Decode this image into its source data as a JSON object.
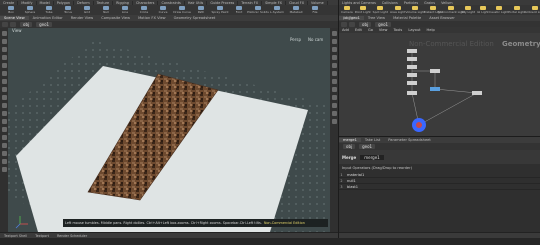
{
  "left_shelf_tabs": [
    "Create",
    "Modify",
    "Model",
    "Polygon",
    "Deform",
    "Texture",
    "Rigging",
    "Characters",
    "Constraints",
    "Hair Utils",
    "Guide Process",
    "Terrain FX",
    "Simple FX",
    "Cloud FX",
    "Volume"
  ],
  "left_tools": [
    "Box",
    "Sphere",
    "Tube",
    "Torus",
    "Grid",
    "Null",
    "Line",
    "Circle",
    "Curve",
    "Draw Curve",
    "Path",
    "Spray Paint",
    "Font",
    "Platonic Solids",
    "L-System",
    "Metaball",
    "File"
  ],
  "right_shelf_tabs": [
    "Lights and Cameras",
    "Collisions",
    "Particles",
    "Grains",
    "Vellum"
  ],
  "lights_tools": [
    "Camera",
    "Point Light",
    "Spot Light",
    "Area Light",
    "Volume Light",
    "Distant Light",
    "Environment Light",
    "Sky Light",
    "GI Light",
    "Caustic Light",
    "Portal Light",
    "Ambient Light"
  ],
  "viewport_tabs": [
    "Scene View",
    "Animation Editor",
    "Render View",
    "Composite View",
    "Motion FX View",
    "Geometry Spreadsheet"
  ],
  "viewport_path": {
    "obj": "obj",
    "node": "geo1"
  },
  "viewport_label": "View",
  "viewport_persp": "Persp",
  "viewport_cam": "No cam",
  "viewport_status": "Left mouse tumbles. Middle pans. Right dollies. Ctrl+Alt+Left box-zooms. Ctrl+Right zooms. Spacebar-Ctrl-Left tilts.",
  "viewport_status_highlight": "Non-Commercial Edition",
  "network_tabs": [
    "/obj/geo1",
    "Tree View",
    "Material Palette",
    "Asset Browser"
  ],
  "network_path": {
    "obj": "obj",
    "node": "geo1"
  },
  "network_menu": [
    "Add",
    "Edit",
    "Go",
    "View",
    "Tools",
    "Layout",
    "Help"
  ],
  "network_watermark": "Non-Commercial Edition",
  "network_context_label": "Geometry",
  "param_tabs": [
    "merge1",
    "Take List",
    "Parameter Spreadsheet"
  ],
  "param_path": {
    "obj": "obj",
    "node": "geo1"
  },
  "param_node_type": "Merge",
  "param_node_name": "merge1",
  "param_section": "Input Operators (Drag/Drop to reorder)",
  "input_operators": [
    {
      "num": "1",
      "name": "material1"
    },
    {
      "num": "2",
      "name": "null1"
    },
    {
      "num": "3",
      "name": "blast1"
    }
  ],
  "bottom_tabs": [
    "Textport Shell",
    "Textport",
    "Render Scheduler"
  ],
  "colors": {
    "ground": "#dfe4e4",
    "rock": "#6e4a2f",
    "viewport_bg": "#3f4a4b",
    "selected_node": "#3a67ff"
  }
}
